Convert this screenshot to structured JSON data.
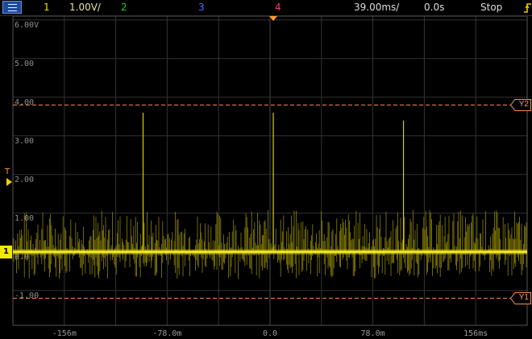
{
  "topbar": {
    "channel1_num": "1",
    "channel1_scale": "1.00V/",
    "channel2_num": "2",
    "channel3_num": "3",
    "channel4_num": "4",
    "timebase": "39.00ms/",
    "delay": "0.0s",
    "run_state": "Stop"
  },
  "colors": {
    "ch1": "#e8e000",
    "ch2": "#20d020",
    "ch3": "#3060ff",
    "ch4": "#ff3060",
    "cursor": "#ff8c50",
    "trigger": "#ff9a30"
  },
  "y_axis": {
    "labels": [
      "6.00V",
      "5.00",
      "4.00",
      "3.00",
      "2.00",
      "1.00",
      "0.0",
      "-1.00"
    ]
  },
  "x_axis": {
    "labels": [
      "-156m",
      "-78.0m",
      "0.0",
      "78.0m",
      "156ms"
    ]
  },
  "cursors": {
    "y2_label": "Y2",
    "y1_label": "Y1",
    "y2_value": 3.8,
    "y1_value": -1.2
  },
  "trigger": {
    "marker_label": "T",
    "level": 1.8
  },
  "channel_marker": {
    "label": "1"
  },
  "chart_data": {
    "type": "line",
    "series": [
      {
        "channel": "1",
        "baseline": 0.0,
        "noise_range": [
          -0.7,
          1.1
        ],
        "spikes": [
          {
            "x": -0.1,
            "y": 3.6
          },
          {
            "x": 0.0,
            "y": 3.6
          },
          {
            "x": 0.1,
            "y": 3.4
          }
        ]
      }
    ],
    "xlim": [
      -0.2,
      0.195
    ],
    "ylim": [
      -1.9,
      6.1
    ],
    "grid": true
  }
}
